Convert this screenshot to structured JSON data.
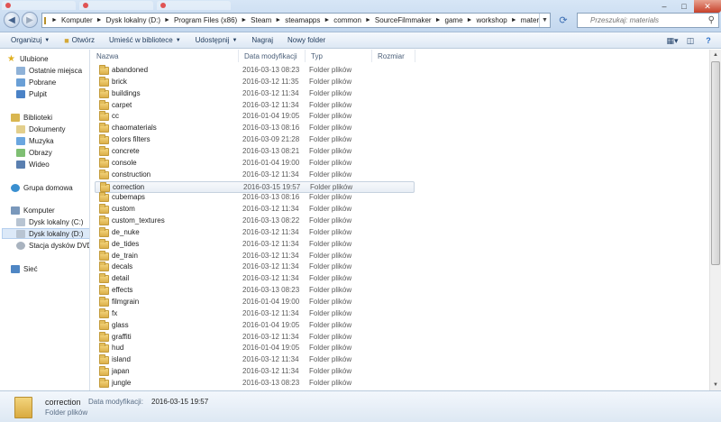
{
  "address": {
    "crumbs": [
      "Komputer",
      "Dysk lokalny (D:)",
      "Program Files (x86)",
      "Steam",
      "steamapps",
      "common",
      "SourceFilmmaker",
      "game",
      "workshop",
      "materials"
    ],
    "search_placeholder": "Przeszukaj: materials"
  },
  "toolbar": {
    "organize": "Organizuj",
    "open": "Otwórz",
    "include_library": "Umieść w bibliotece",
    "share": "Udostępnij",
    "burn": "Nagraj",
    "new_folder": "Nowy folder"
  },
  "nav": {
    "favorites": "Ulubione",
    "recent": "Ostatnie miejsca",
    "downloads": "Pobrane",
    "desktop": "Pulpit",
    "libraries": "Biblioteki",
    "documents": "Dokumenty",
    "music": "Muzyka",
    "pictures": "Obrazy",
    "video": "Wideo",
    "homegroup": "Grupa domowa",
    "computer": "Komputer",
    "drive_c": "Dysk lokalny (C:)",
    "drive_d": "Dysk lokalny (D:)",
    "dvd": "Stacja dysków DVD RW",
    "network": "Sieć"
  },
  "columns": {
    "name": "Nazwa",
    "date": "Data modyfikacji",
    "type": "Typ",
    "size": "Rozmiar"
  },
  "files": [
    {
      "name": "abandoned",
      "date": "2016-03-13 08:23",
      "type": "Folder plików"
    },
    {
      "name": "brick",
      "date": "2016-03-12 11:35",
      "type": "Folder plików"
    },
    {
      "name": "buildings",
      "date": "2016-03-12 11:34",
      "type": "Folder plików"
    },
    {
      "name": "carpet",
      "date": "2016-03-12 11:34",
      "type": "Folder plików"
    },
    {
      "name": "cc",
      "date": "2016-01-04 19:05",
      "type": "Folder plików"
    },
    {
      "name": "chaomaterials",
      "date": "2016-03-13 08:16",
      "type": "Folder plików"
    },
    {
      "name": "colors filters",
      "date": "2016-03-09 21:28",
      "type": "Folder plików"
    },
    {
      "name": "concrete",
      "date": "2016-03-13 08:21",
      "type": "Folder plików"
    },
    {
      "name": "console",
      "date": "2016-01-04 19:00",
      "type": "Folder plików"
    },
    {
      "name": "construction",
      "date": "2016-03-12 11:34",
      "type": "Folder plików"
    },
    {
      "name": "correction",
      "date": "2016-03-15 19:57",
      "type": "Folder plików"
    },
    {
      "name": "cubemaps",
      "date": "2016-03-13 08:16",
      "type": "Folder plików"
    },
    {
      "name": "custom",
      "date": "2016-03-12 11:34",
      "type": "Folder plików"
    },
    {
      "name": "custom_textures",
      "date": "2016-03-13 08:22",
      "type": "Folder plików"
    },
    {
      "name": "de_nuke",
      "date": "2016-03-12 11:34",
      "type": "Folder plików"
    },
    {
      "name": "de_tides",
      "date": "2016-03-12 11:34",
      "type": "Folder plików"
    },
    {
      "name": "de_train",
      "date": "2016-03-12 11:34",
      "type": "Folder plików"
    },
    {
      "name": "decals",
      "date": "2016-03-12 11:34",
      "type": "Folder plików"
    },
    {
      "name": "detail",
      "date": "2016-03-12 11:34",
      "type": "Folder plików"
    },
    {
      "name": "effects",
      "date": "2016-03-13 08:23",
      "type": "Folder plików"
    },
    {
      "name": "filmgrain",
      "date": "2016-01-04 19:00",
      "type": "Folder plików"
    },
    {
      "name": "fx",
      "date": "2016-03-12 11:34",
      "type": "Folder plików"
    },
    {
      "name": "glass",
      "date": "2016-01-04 19:05",
      "type": "Folder plików"
    },
    {
      "name": "graffiti",
      "date": "2016-03-12 11:34",
      "type": "Folder plików"
    },
    {
      "name": "hud",
      "date": "2016-01-04 19:05",
      "type": "Folder plików"
    },
    {
      "name": "island",
      "date": "2016-03-12 11:34",
      "type": "Folder plików"
    },
    {
      "name": "japan",
      "date": "2016-03-12 11:34",
      "type": "Folder plików"
    },
    {
      "name": "jungle",
      "date": "2016-03-13 08:23",
      "type": "Folder plików"
    }
  ],
  "selected_index": 10,
  "details": {
    "name": "correction",
    "date_label": "Data modyfikacji:",
    "date_value": "2016-03-15 19:57",
    "type": "Folder plików"
  }
}
